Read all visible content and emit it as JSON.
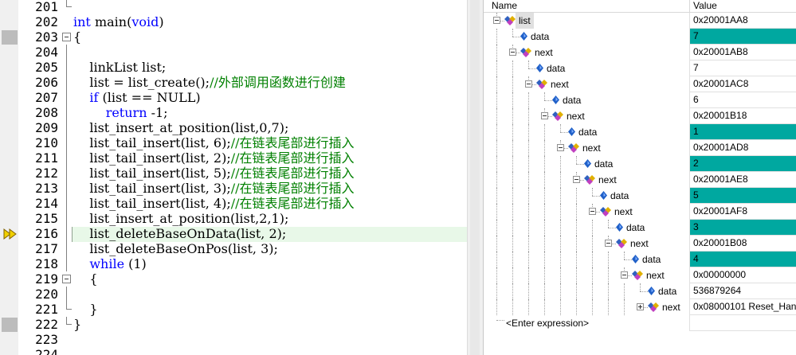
{
  "editor": {
    "lines": [
      {
        "no": "201",
        "text": ""
      },
      {
        "no": "202",
        "text": "int main(void)"
      },
      {
        "no": "203",
        "text": "{"
      },
      {
        "no": "204",
        "text": ""
      },
      {
        "no": "205",
        "text": "    linkList list;"
      },
      {
        "no": "206",
        "text": "    list = list_create();//外部调用函数进行创建"
      },
      {
        "no": "207",
        "text": "    if (list == NULL)"
      },
      {
        "no": "208",
        "text": "        return -1;"
      },
      {
        "no": "209",
        "text": "    list_insert_at_position(list,0,7);"
      },
      {
        "no": "210",
        "text": "    list_tail_insert(list, 6);//在链表尾部进行插入"
      },
      {
        "no": "211",
        "text": "    list_tail_insert(list, 2);//在链表尾部进行插入"
      },
      {
        "no": "212",
        "text": "    list_tail_insert(list, 5);//在链表尾部进行插入"
      },
      {
        "no": "213",
        "text": "    list_tail_insert(list, 3);//在链表尾部进行插入"
      },
      {
        "no": "214",
        "text": "    list_tail_insert(list, 4);//在链表尾部进行插入"
      },
      {
        "no": "215",
        "text": "    list_insert_at_position(list,2,1);"
      },
      {
        "no": "216",
        "text": "    list_deleteBaseOnData(list, 2);"
      },
      {
        "no": "217",
        "text": "    list_deleteBaseOnPos(list, 3);"
      },
      {
        "no": "218",
        "text": "    while (1)"
      },
      {
        "no": "219",
        "text": "    {"
      },
      {
        "no": "220",
        "text": ""
      },
      {
        "no": "221",
        "text": "    }"
      },
      {
        "no": "222",
        "text": "}"
      },
      {
        "no": "223",
        "text": ""
      },
      {
        "no": "224",
        "text": ""
      }
    ],
    "current_line": "216"
  },
  "watch": {
    "header_name": "Name",
    "header_value": "Value",
    "rows": [
      {
        "name": "list",
        "value": "0x20001AA8",
        "kind": "struct",
        "highlight": false
      },
      {
        "name": "data",
        "value": "7",
        "kind": "field",
        "highlight": true
      },
      {
        "name": "next",
        "value": "0x20001AB8",
        "kind": "struct",
        "highlight": false
      },
      {
        "name": "data",
        "value": "7",
        "kind": "field",
        "highlight": false
      },
      {
        "name": "next",
        "value": "0x20001AC8",
        "kind": "struct",
        "highlight": false
      },
      {
        "name": "data",
        "value": "6",
        "kind": "field",
        "highlight": false
      },
      {
        "name": "next",
        "value": "0x20001B18",
        "kind": "struct",
        "highlight": false
      },
      {
        "name": "data",
        "value": "1",
        "kind": "field",
        "highlight": true
      },
      {
        "name": "next",
        "value": "0x20001AD8",
        "kind": "struct",
        "highlight": false
      },
      {
        "name": "data",
        "value": "2",
        "kind": "field",
        "highlight": true
      },
      {
        "name": "next",
        "value": "0x20001AE8",
        "kind": "struct",
        "highlight": false
      },
      {
        "name": "data",
        "value": "5",
        "kind": "field",
        "highlight": true
      },
      {
        "name": "next",
        "value": "0x20001AF8",
        "kind": "struct",
        "highlight": false
      },
      {
        "name": "data",
        "value": "3",
        "kind": "field",
        "highlight": true
      },
      {
        "name": "next",
        "value": "0x20001B08",
        "kind": "struct",
        "highlight": false
      },
      {
        "name": "data",
        "value": "4",
        "kind": "field",
        "highlight": true
      },
      {
        "name": "next",
        "value": "0x00000000",
        "kind": "struct",
        "highlight": false
      },
      {
        "name": "data",
        "value": "536879264",
        "kind": "field",
        "highlight": false
      },
      {
        "name": "next",
        "value": "0x08000101 Reset_Han...",
        "kind": "struct",
        "highlight": false
      }
    ],
    "enter_expression": "<Enter expression>",
    "highlight_color": "#00a8a0"
  }
}
